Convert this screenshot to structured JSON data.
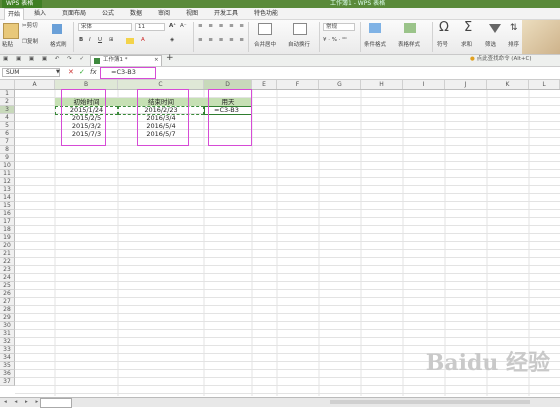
{
  "titlebar": {
    "app_label": "WPS 表格",
    "doc_title": "工作簿1 - WPS 表格"
  },
  "menu": [
    "开始",
    "插入",
    "页面布局",
    "公式",
    "数据",
    "审阅",
    "视图",
    "开发工具",
    "特色功能"
  ],
  "ribbon": {
    "cut": "剪切",
    "copy": "复制",
    "paste": "粘贴",
    "format_painter": "格式刷",
    "font_name": "宋体",
    "font_size": "11",
    "merge": "合并居中",
    "wrap": "自动换行",
    "number_format": "常规",
    "cond_format": "条件格式",
    "table_style": "表格样式",
    "symbol": "符号",
    "sum": "求和",
    "filter": "筛选",
    "sort": "排序"
  },
  "tabstrip": {
    "file_tab": "工作簿1 *",
    "hint": "点此查找命令 (Alt+C)"
  },
  "formula_bar": {
    "name_box": "SUM",
    "formula": "=C3-B3",
    "cancel": "✕",
    "confirm": "✓",
    "fx": "fx"
  },
  "columns": [
    "A",
    "B",
    "C",
    "D",
    "E",
    "F",
    "G",
    "H",
    "I",
    "J",
    "K",
    "L"
  ],
  "rows": [
    "1",
    "2",
    "3",
    "4",
    "5",
    "6",
    "7",
    "8",
    "9",
    "10",
    "11",
    "12",
    "13",
    "14",
    "15",
    "16",
    "17",
    "18",
    "19",
    "20",
    "21",
    "22",
    "23",
    "24",
    "25",
    "26",
    "27",
    "28",
    "29",
    "30",
    "31",
    "32",
    "33",
    "34",
    "35",
    "36",
    "37"
  ],
  "table": {
    "headers": {
      "start": "初始时间",
      "end": "结束时间",
      "days": "用天"
    },
    "start_dates": [
      "2015/1/24",
      "2015/2/5",
      "2015/3/2",
      "2015/7/3"
    ],
    "end_dates": [
      "2016/2/23",
      "2016/3/4",
      "2016/5/4",
      "2016/5/7"
    ],
    "editing": "=C3-B3"
  },
  "watermark": "Baidu 经验",
  "colors": {
    "green_header": "#c6e0b4",
    "highlight": "#d64bd6",
    "titlebar": "#5a8a3a"
  }
}
